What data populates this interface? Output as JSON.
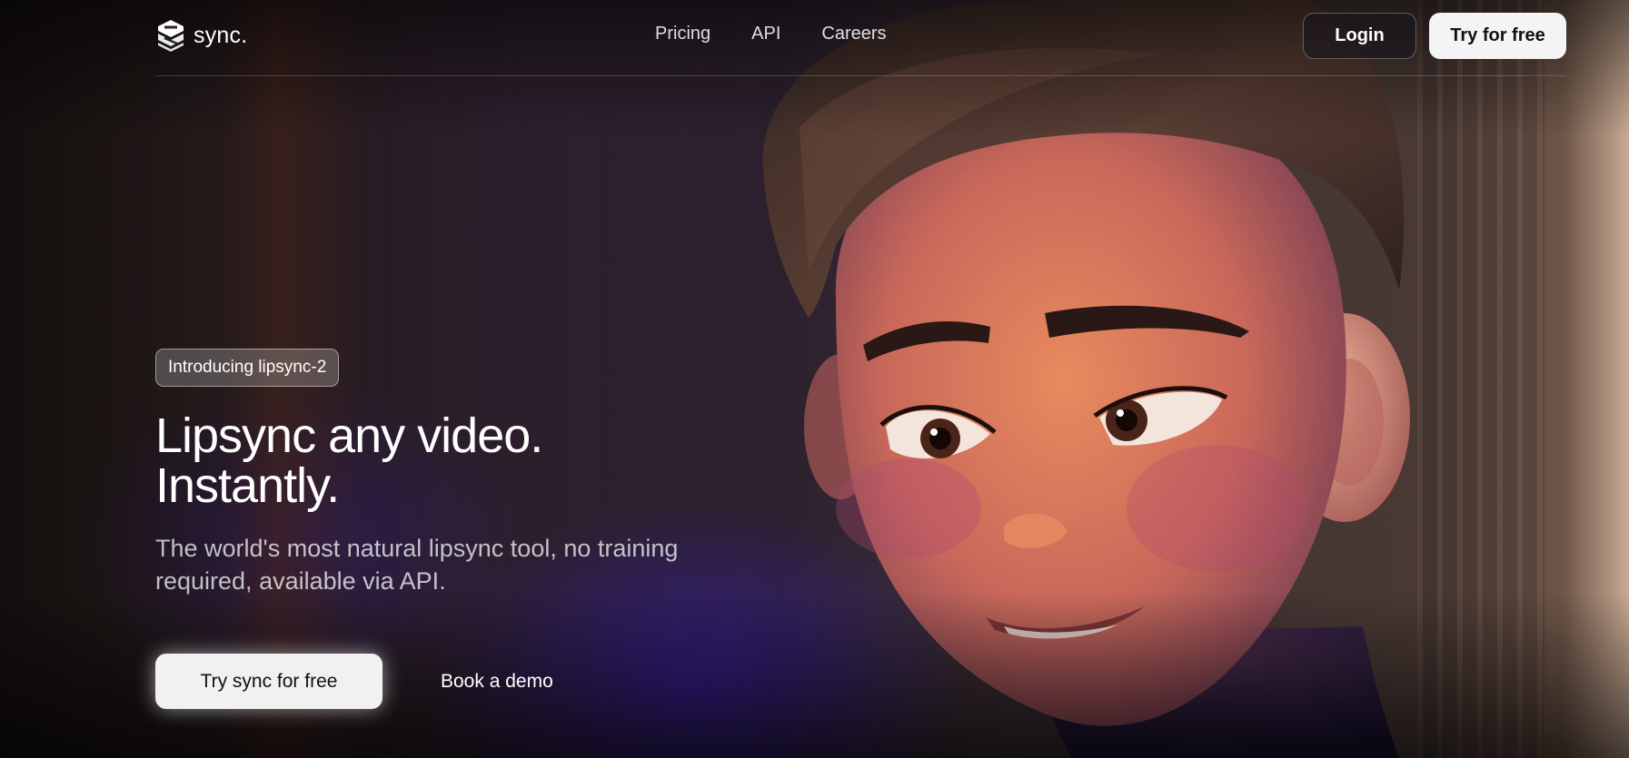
{
  "brand": {
    "name": "sync.",
    "logo_icon": "sync-logo-icon"
  },
  "nav": {
    "items": [
      {
        "label": "Pricing"
      },
      {
        "label": "API"
      },
      {
        "label": "Careers"
      }
    ]
  },
  "header": {
    "login_label": "Login",
    "try_label": "Try for free"
  },
  "hero": {
    "badge": "Introducing lipsync-2",
    "headline_line1": "Lipsync any video.",
    "headline_line2": "Instantly.",
    "subtext": "The world's most natural lipsync tool, no training required, available via API.",
    "cta_primary": "Try sync for free",
    "cta_secondary": "Book a demo"
  },
  "colors": {
    "accent_glow": "#3c1ec8",
    "button_bg": "#f4f4f4",
    "background": "#0b0a12"
  }
}
